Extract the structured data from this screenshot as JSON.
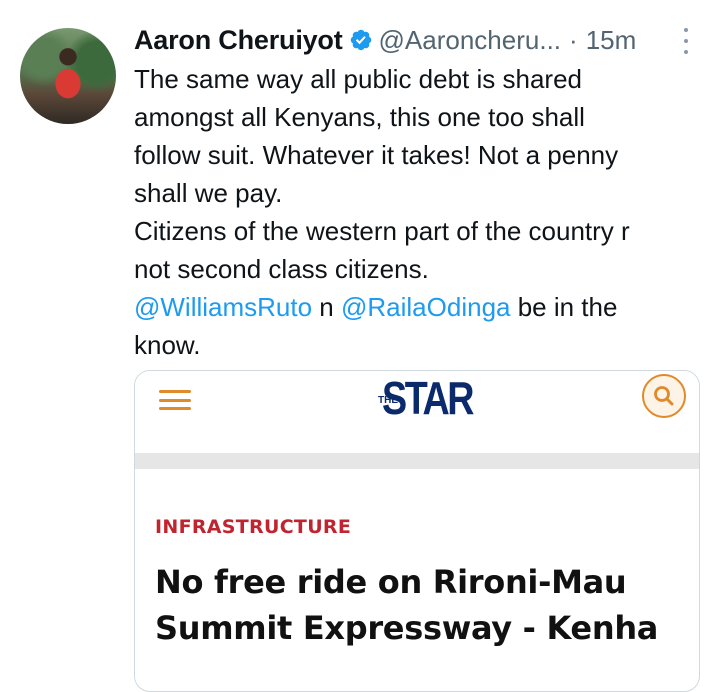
{
  "tweet": {
    "author_name": "Aaron Cheruiyot",
    "handle": "@Aaroncheru...",
    "separator": "·",
    "time": "15m",
    "lines": [
      "The same way all public debt is shared",
      "amongst all Kenyans, this one too shall",
      "follow suit. Whatever it takes! Not a penny",
      "shall we pay.",
      "Citizens of the western part of the country r",
      "not second class citizens."
    ],
    "mention_line": {
      "mention1": "@WilliamsRuto",
      "connector": " n ",
      "mention2": "@RailaOdinga",
      "after": " be in the"
    },
    "last_line": "know."
  },
  "card": {
    "logo_prefix": "THE",
    "logo_text": "STAR",
    "category": "INFRASTRUCTURE",
    "headline_lines": [
      "No free ride on Rironi-Mau",
      "Summit Expressway - Kenha"
    ]
  },
  "colors": {
    "link": "#1d9bf0",
    "verified": "#1d9bf0",
    "category": "#c0242f",
    "logo": "#0a2a6b",
    "accent": "#e08a2a"
  },
  "icons": {
    "verified": "verified-badge-icon",
    "more": "more-options-icon",
    "menu": "hamburger-menu-icon",
    "search": "search-icon"
  }
}
